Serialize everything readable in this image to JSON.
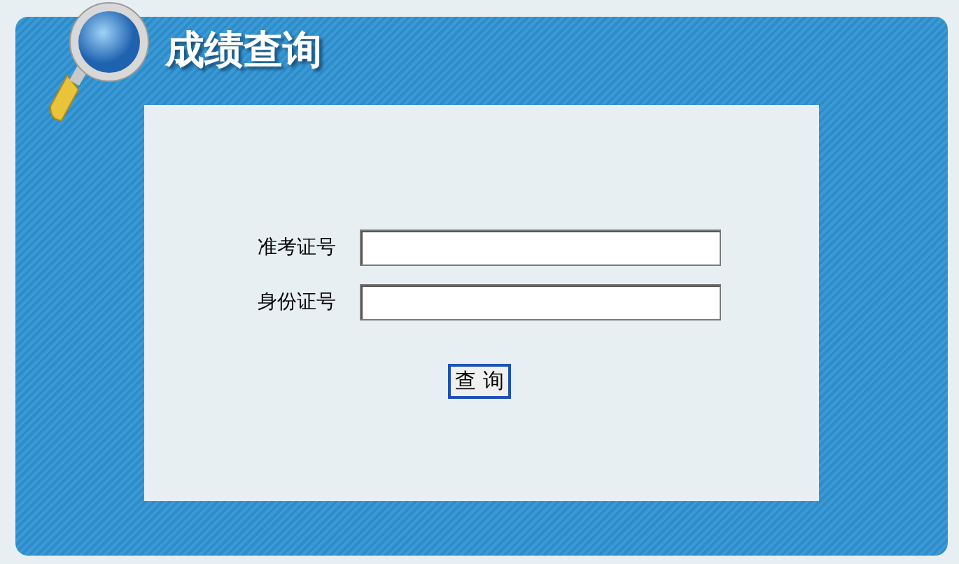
{
  "title": "成绩查询",
  "fields": [
    {
      "label": "准考证号"
    },
    {
      "label": "身份证号"
    }
  ],
  "button": "查 询"
}
